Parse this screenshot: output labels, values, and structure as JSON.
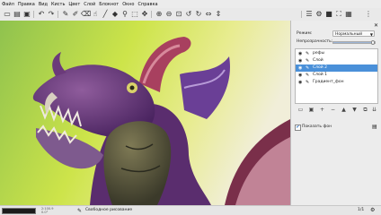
{
  "menu": [
    "Файл",
    "Правка",
    "Вид",
    "Кисть",
    "Цвет",
    "Слой",
    "Блокнот",
    "Окно",
    "Справка"
  ],
  "toolbar": {
    "icons": [
      "new-file",
      "open-file",
      "save-file",
      "undo",
      "redo",
      "brush-tool",
      "pen-tool",
      "eraser-tool",
      "smudge-tool",
      "line-tool",
      "fill-tool",
      "eyedropper-tool",
      "select-tool",
      "transform-tool",
      "zoom-in",
      "zoom-out",
      "zoom-fit",
      "rotate-left",
      "rotate-right",
      "flip-horizontal",
      "flip-vertical",
      "layers-panel",
      "settings",
      "background-toggle",
      "fullscreen",
      "scratchpad"
    ]
  },
  "panel": {
    "mode_label": "Режим:",
    "mode_value": "Нормальный",
    "opacity_label": "Непрозрачность:",
    "opacity": 0.95,
    "layers": [
      {
        "name": "рефы",
        "visible": true,
        "selected": false
      },
      {
        "name": "Слой",
        "visible": true,
        "selected": false
      },
      {
        "name": "Слой 2",
        "visible": true,
        "selected": true
      },
      {
        "name": "Слой 1",
        "visible": true,
        "selected": false
      },
      {
        "name": "Градиент_фон",
        "visible": true,
        "selected": false
      }
    ],
    "show_bg_label": "Показать фон",
    "show_bg_checked": true
  },
  "status": {
    "zoom": "2:100.9",
    "angle": "0.0°",
    "mode_text": "Свободное рисование",
    "page": "1/1"
  }
}
